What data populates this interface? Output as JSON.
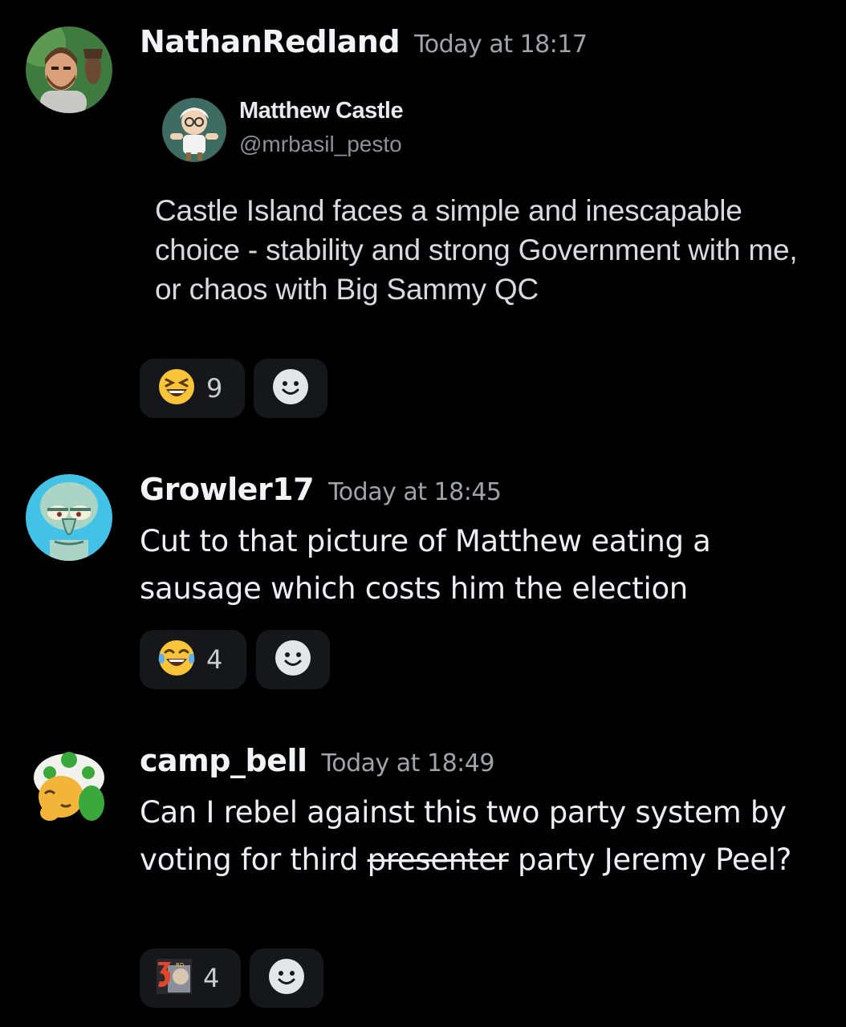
{
  "messages": [
    {
      "username": "NathanRedland",
      "timestamp": "Today at 18:17",
      "embed": {
        "author_name": "Matthew Castle",
        "author_handle": "@mrbasil_pesto",
        "text": "Castle Island faces a simple and inescapable choice - stability and strong Government with me, or chaos with Big Sammy QC"
      },
      "reaction": {
        "emoji": "grinning-squinting-face",
        "count": "9"
      }
    },
    {
      "username": "Growler17",
      "timestamp": "Today at 18:45",
      "text": "Cut to that picture of Matthew eating a sausage which costs him the election",
      "reaction": {
        "emoji": "face-with-tears-of-joy",
        "count": "4"
      }
    },
    {
      "username": "camp_bell",
      "timestamp": "Today at 18:49",
      "text_before": "Can I rebel against this two party system by voting for third ",
      "text_strike": "presenter",
      "text_after": " party Jeremy Peel?",
      "reaction": {
        "emoji": "custom-server-emoji",
        "count": "4"
      }
    }
  ],
  "colors": {
    "background": "#000000",
    "reaction_bg": "#16171b",
    "timestamp": "#a0a3aa"
  }
}
